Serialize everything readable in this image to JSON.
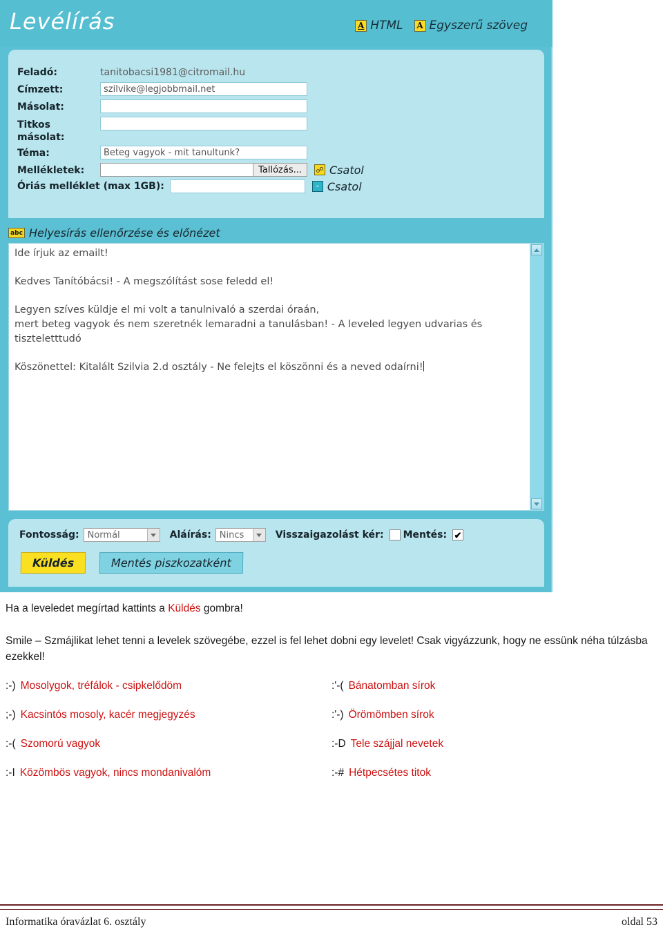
{
  "screenshot": {
    "app_title": "Levélírás",
    "mode_switch": [
      {
        "icon": "a-underlined-icon",
        "label": "HTML"
      },
      {
        "icon": "a-plain-icon",
        "label": "Egyszerű szöveg"
      }
    ],
    "form": {
      "from_label": "Feladó:",
      "from_value": "tanitobacsi1981@citromail.hu",
      "to_label": "Címzett:",
      "to_value": "szilvike@legjobbmail.net",
      "cc_label": "Másolat:",
      "cc_value": "",
      "bcc_label_line1": "Titkos",
      "bcc_label_line2": "másolat:",
      "bcc_value": "",
      "subject_label": "Téma:",
      "subject_value": "Beteg vagyok - mit tanultunk?",
      "attach_label": "Mellékletek:",
      "attach_value": "",
      "browse_button": "Tallózás...",
      "attach_action": "Csatol",
      "big_attach_label": "Óriás melléklet (max 1GB):",
      "big_attach_value": "",
      "big_attach_action": "Csatol"
    },
    "spellcheck": {
      "icon_text": "abc",
      "label": "Helyesírás ellenőrzése és előnézet"
    },
    "editor": {
      "line1": "Ide írjuk az emailt!",
      "line2": "Kedves Tanítóbácsi! - A megszólítást sose feledd el!",
      "line3a": "Legyen szíves küldje el mi volt a tanulnivaló a szerdai óraán,",
      "line3b": "mert beteg vagyok és nem szeretnék lemaradni a tanulásban! - A leveled legyen udvarias és",
      "line3c": "tiszteletttudó",
      "line4": "Köszönettel: Kitalált Szilvia 2.d osztály - Ne felejts el köszönni és a neved odaírni!"
    },
    "options": {
      "priority_label": "Fontosság:",
      "priority_value": "Normál",
      "signature_label": "Aláírás:",
      "signature_value": "Nincs",
      "receipt_label": "Visszaigazolást kér:",
      "receipt_checked": "",
      "save_label": "Mentés:",
      "save_checked": "✔",
      "send_button": "Küldés",
      "draft_button": "Mentés piszkozatként"
    }
  },
  "document": {
    "para1_before": "Ha a leveledet megírtad kattints a ",
    "para1_highlight": "Küldés",
    "para1_after": " gombra!",
    "para2": "Smile – Szmájlikat lehet tenni a levelek szövegébe, ezzel is fel lehet dobni egy levelet! Csak vigyázzunk, hogy ne essünk néha túlzásba ezekkel!",
    "emoticons": [
      {
        "sym": ":-)",
        "desc": "Mosolygok, tréfálok - csipkelődöm"
      },
      {
        "sym": ":'-(",
        "desc": "Bánatomban sírok"
      },
      {
        "sym": ";-)",
        "desc": "Kacsintós mosoly, kacér megjegyzés"
      },
      {
        "sym": ":'-)",
        "desc": "Örömömben sírok"
      },
      {
        "sym": ":-(",
        "desc": "Szomorú vagyok"
      },
      {
        "sym": ":-D",
        "desc": "Tele szájjal nevetek"
      },
      {
        "sym": ":-I",
        "desc": "Közömbös vagyok, nincs mondanivalóm"
      },
      {
        "sym": ":-#",
        "desc": "Hétpecsétes titok"
      }
    ],
    "footer_left": "Informatika óravázlat 6. osztály",
    "footer_right": "oldal 53"
  },
  "colors": {
    "header_teal": "#55bed1",
    "panel_light": "#b9e5ee",
    "accent_yellow": "#fbe022",
    "highlight_red": "#cc1111",
    "footer_rule": "#6b2020"
  }
}
